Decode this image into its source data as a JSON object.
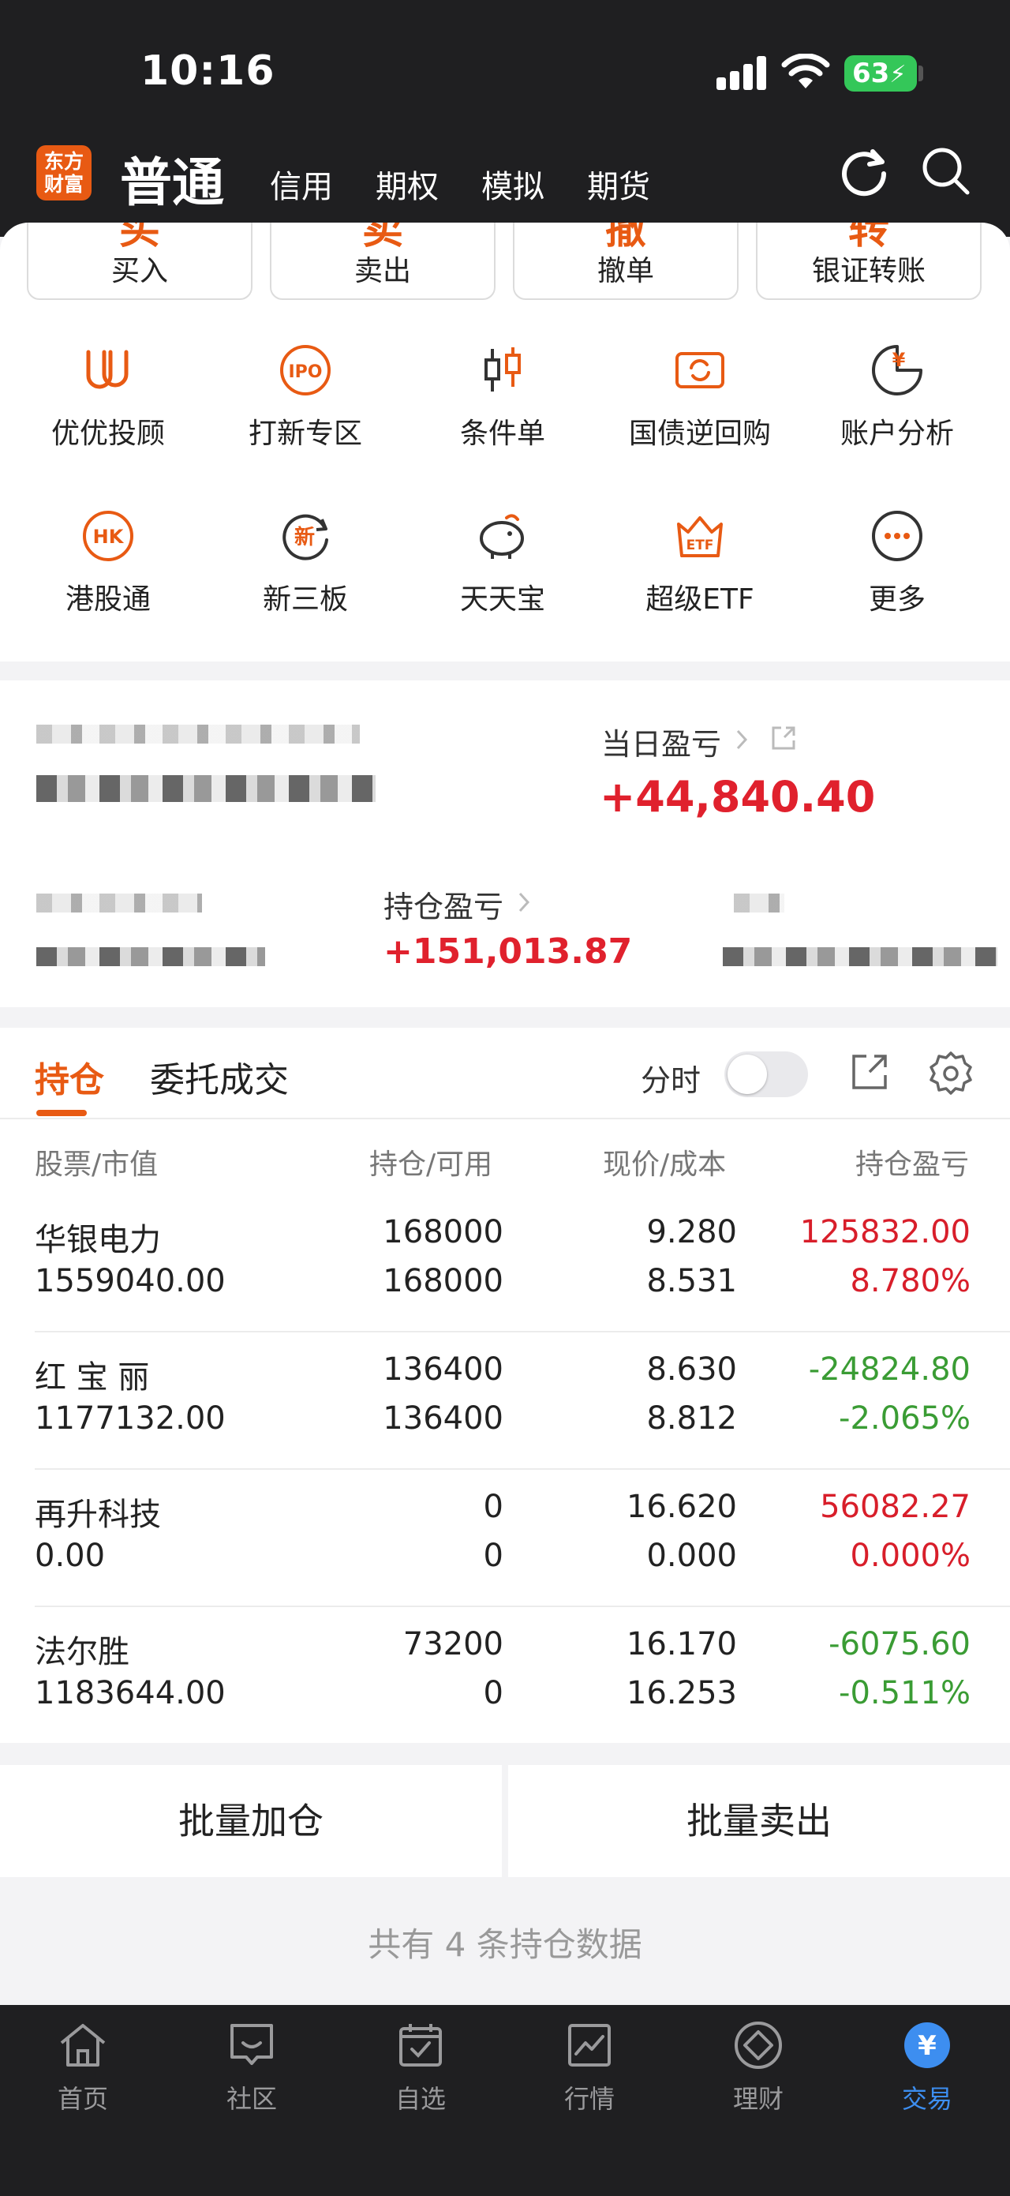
{
  "status_bar": {
    "time": "10:16",
    "battery": "63"
  },
  "header": {
    "logo_line1": "东方",
    "logo_line2": "财富",
    "account_type": "普通",
    "tabs": [
      "信用",
      "期权",
      "模拟",
      "期货"
    ]
  },
  "quick_actions": [
    {
      "char": "买",
      "label": "买入"
    },
    {
      "char": "卖",
      "label": "卖出"
    },
    {
      "char": "撤",
      "label": "撤单"
    },
    {
      "char": "转",
      "label": "银证转账"
    }
  ],
  "grid_row1": [
    {
      "label": "优优投顾",
      "icon": "uu-icon"
    },
    {
      "label": "打新专区",
      "icon": "ipo-icon",
      "icon_text": "IPO"
    },
    {
      "label": "条件单",
      "icon": "candlestick-icon"
    },
    {
      "label": "国债逆回购",
      "icon": "bond-repo-icon"
    },
    {
      "label": "账户分析",
      "icon": "account-analysis-icon",
      "icon_text": "¥"
    }
  ],
  "grid_row2": [
    {
      "label": "港股通",
      "icon": "hk-icon",
      "icon_text": "HK"
    },
    {
      "label": "新三板",
      "icon": "neeq-icon",
      "icon_text": "新"
    },
    {
      "label": "天天宝",
      "icon": "piggy-bank-icon"
    },
    {
      "label": "超级ETF",
      "icon": "etf-icon",
      "icon_text": "ETF"
    },
    {
      "label": "更多",
      "icon": "more-icon"
    }
  ],
  "profit": {
    "daily_label": "当日盈亏",
    "daily_value": "+44,840.40",
    "position_label": "持仓盈亏",
    "position_value": "+151,013.87"
  },
  "positions": {
    "tab_active": "持仓",
    "tab_other": "委托成交",
    "timeshare_label": "分时",
    "columns": [
      "股票/市值",
      "持仓/可用",
      "现价/成本",
      "持仓盈亏"
    ],
    "rows": [
      {
        "name": "华银电力",
        "market_value": "1559040.00",
        "holding": "168000",
        "available": "168000",
        "price": "9.280",
        "cost": "8.531",
        "pnl": "125832.00",
        "pnl_pct": "8.780%",
        "trend": "up"
      },
      {
        "name": "红 宝 丽",
        "market_value": "1177132.00",
        "holding": "136400",
        "available": "136400",
        "price": "8.630",
        "cost": "8.812",
        "pnl": "-24824.80",
        "pnl_pct": "-2.065%",
        "trend": "down"
      },
      {
        "name": "再升科技",
        "market_value": "0.00",
        "holding": "0",
        "available": "0",
        "price": "16.620",
        "cost": "0.000",
        "pnl": "56082.27",
        "pnl_pct": "0.000%",
        "trend": "up"
      },
      {
        "name": "法尔胜",
        "market_value": "1183644.00",
        "holding": "73200",
        "available": "0",
        "price": "16.170",
        "cost": "16.253",
        "pnl": "-6075.60",
        "pnl_pct": "-0.511%",
        "trend": "down"
      }
    ],
    "batch_add": "批量加仓",
    "batch_sell": "批量卖出",
    "count_text": "共有 4 条持仓数据"
  },
  "colors": {
    "accent": "#e85a13",
    "up": "#d81e2a",
    "down": "#3a9c34",
    "tab_active": "#3d8ef0"
  },
  "bottom_tabs": [
    {
      "label": "首页",
      "icon": "home-icon"
    },
    {
      "label": "社区",
      "icon": "community-icon"
    },
    {
      "label": "自选",
      "icon": "watchlist-icon"
    },
    {
      "label": "行情",
      "icon": "market-icon"
    },
    {
      "label": "理财",
      "icon": "wealth-icon"
    },
    {
      "label": "交易",
      "icon": "trade-icon",
      "icon_text": "¥",
      "active": true
    }
  ]
}
